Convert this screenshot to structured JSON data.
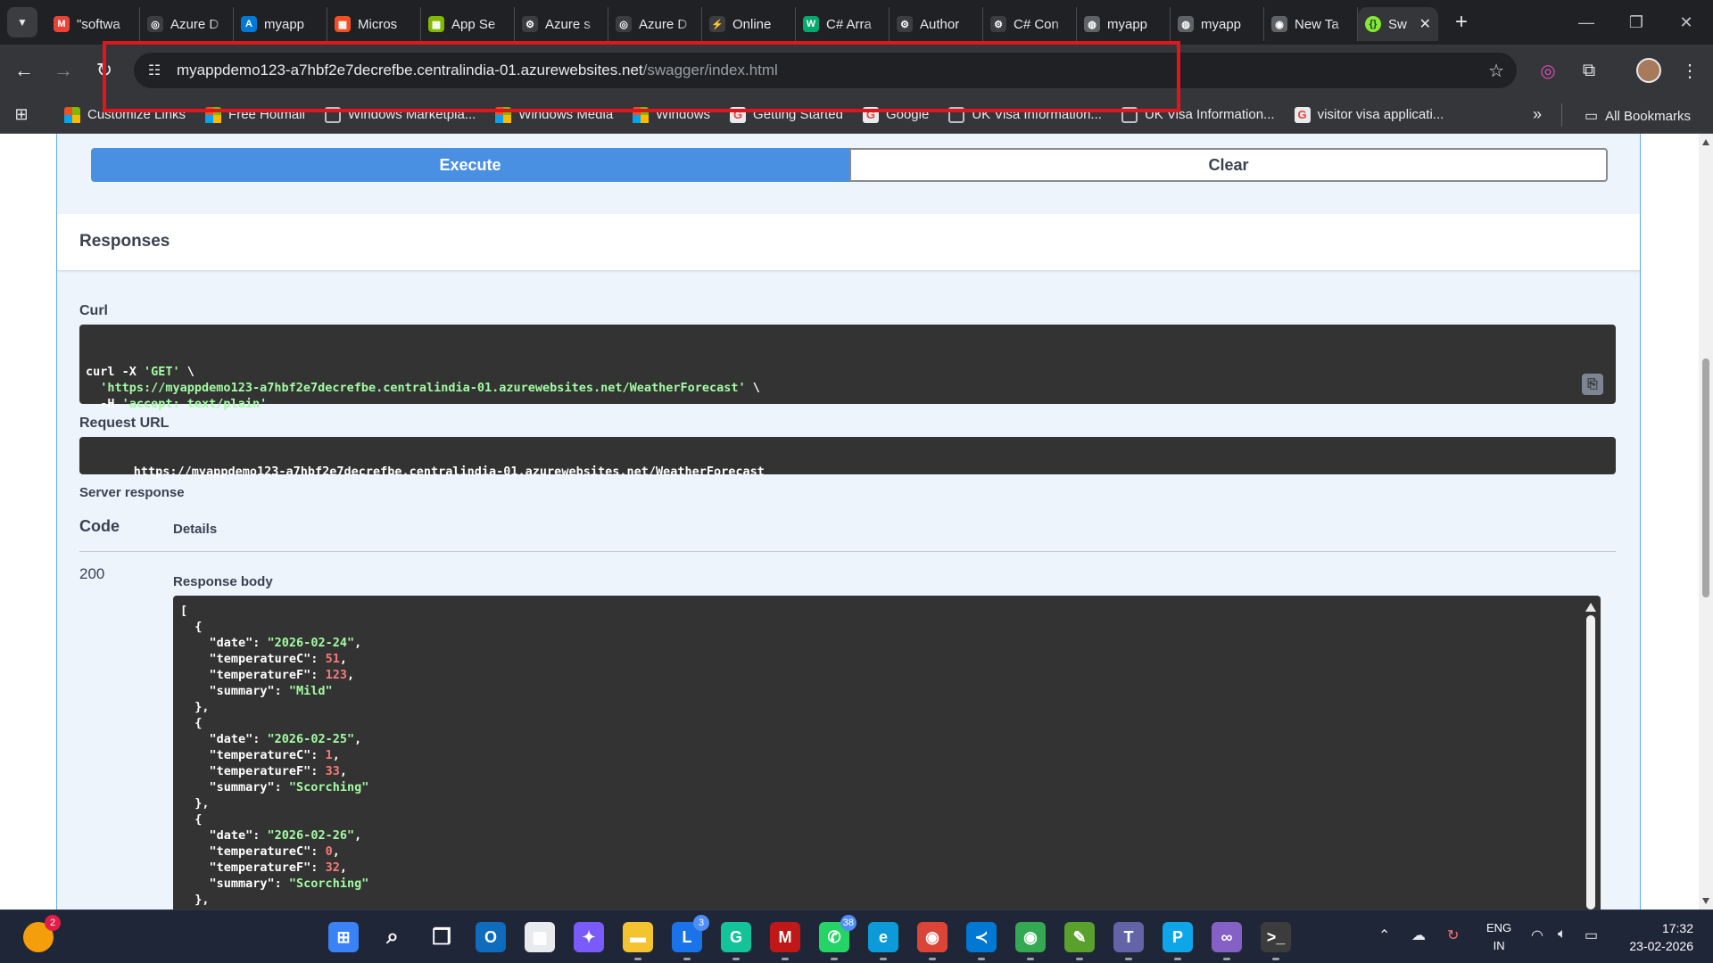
{
  "browser": {
    "tabs": [
      {
        "title": "\"softwa",
        "icon": "gmail-icon",
        "color": "#ea4335",
        "glyph": "M"
      },
      {
        "title": "Azure D",
        "icon": "openai-icon",
        "color": "#3c3d41",
        "glyph": "◎"
      },
      {
        "title": "myapp",
        "icon": "azure-icon",
        "color": "#0078d4",
        "glyph": "A"
      },
      {
        "title": "Micros",
        "icon": "microsoft-icon",
        "color": "#f25022",
        "glyph": "▦"
      },
      {
        "title": "App Se",
        "icon": "microsoft-icon",
        "color": "#7fba00",
        "glyph": "▦"
      },
      {
        "title": "Azure s",
        "icon": "azure-ai-icon",
        "color": "#3c3d41",
        "glyph": "⚙"
      },
      {
        "title": "Azure D",
        "icon": "openai-icon",
        "color": "#3c3d41",
        "glyph": "◎"
      },
      {
        "title": "Online",
        "icon": "online-icon",
        "color": "#3c3d41",
        "glyph": "⚡"
      },
      {
        "title": "C# Arra",
        "icon": "w3schools-icon",
        "color": "#04aa6d",
        "glyph": "W"
      },
      {
        "title": "Author",
        "icon": "azure-ai-icon",
        "color": "#3c3d41",
        "glyph": "⚙"
      },
      {
        "title": "C# Con",
        "icon": "azure-ai-icon",
        "color": "#3c3d41",
        "glyph": "⚙"
      },
      {
        "title": "myapp",
        "icon": "globe-icon",
        "color": "#5f6368",
        "glyph": "◍"
      },
      {
        "title": "myapp",
        "icon": "globe-icon",
        "color": "#5f6368",
        "glyph": "◍"
      },
      {
        "title": "New Ta",
        "icon": "chrome-icon",
        "color": "#5f6368",
        "glyph": "◉"
      }
    ],
    "active_tab": {
      "title": "Sw",
      "icon": "swagger-icon",
      "color": "#85ea2d",
      "glyph": "{}"
    },
    "url_host": "myappdemo123-a7hbf2e7decrefbe.centralindia-01.azurewebsites.net",
    "url_path": "/swagger/index.html",
    "bookmarks": [
      {
        "label": "Customize Links",
        "icon": "msgrid"
      },
      {
        "label": "Free Hotmail",
        "icon": "msgrid"
      },
      {
        "label": "Windows Marketpla...",
        "icon": "globe"
      },
      {
        "label": "Windows Media",
        "icon": "msgrid"
      },
      {
        "label": "Windows",
        "icon": "msgrid"
      },
      {
        "label": "Getting Started",
        "icon": "g"
      },
      {
        "label": "Google",
        "icon": "g"
      },
      {
        "label": "UK Visa Information...",
        "icon": "globe"
      },
      {
        "label": "UK Visa Information...",
        "icon": "globe"
      },
      {
        "label": "visitor visa applicati...",
        "icon": "g"
      }
    ],
    "all_bookmarks": "All Bookmarks"
  },
  "swagger": {
    "execute_label": "Execute",
    "clear_label": "Clear",
    "responses_title": "Responses",
    "curl_label": "Curl",
    "curl_lines": [
      {
        "plain": "curl -X ",
        "str": "'GET'",
        "tail": " \\"
      },
      {
        "plain": "  ",
        "str": "'https://myappdemo123-a7hbf2e7decrefbe.centralindia-01.azurewebsites.net/WeatherForecast'",
        "tail": " \\"
      },
      {
        "plain": "  -H ",
        "str": "'accept: text/plain'",
        "tail": ""
      }
    ],
    "request_url_label": "Request URL",
    "request_url": "https://myappdemo123-a7hbf2e7decrefbe.centralindia-01.azurewebsites.net/WeatherForecast",
    "server_response_label": "Server response",
    "code_header": "Code",
    "details_header": "Details",
    "status_code": "200",
    "response_body_label": "Response body",
    "response_items": [
      {
        "date": "\"2026-02-24\"",
        "temperatureC": "51",
        "temperatureF": "123",
        "summary": "\"Mild\""
      },
      {
        "date": "\"2026-02-25\"",
        "temperatureC": "1",
        "temperatureF": "33",
        "summary": "\"Scorching\""
      },
      {
        "date": "\"2026-02-26\"",
        "temperatureC": "0",
        "temperatureF": "32",
        "summary": "\"Scorching\""
      }
    ]
  },
  "taskbar": {
    "apps": [
      {
        "name": "start-icon",
        "glyph": "⊞",
        "color": "#3b82f6",
        "badge": ""
      },
      {
        "name": "search-icon",
        "glyph": "⌕",
        "color": "transparent",
        "badge": ""
      },
      {
        "name": "task-view-icon",
        "glyph": "❐",
        "color": "transparent",
        "badge": ""
      },
      {
        "name": "outlook-icon",
        "glyph": "O",
        "color": "#0f6cbd",
        "badge": ""
      },
      {
        "name": "store-icon",
        "glyph": "▦",
        "color": "#e8eaed",
        "badge": ""
      },
      {
        "name": "copilot-icon",
        "glyph": "✦",
        "color": "#7a5af8",
        "badge": ""
      },
      {
        "name": "file-explorer-icon",
        "glyph": "▬",
        "color": "#f4c430",
        "badge": ""
      },
      {
        "name": "l-app-icon",
        "glyph": "L",
        "color": "#1a73e8",
        "badge": "3"
      },
      {
        "name": "grammarly-icon",
        "glyph": "G",
        "color": "#15c39a",
        "badge": ""
      },
      {
        "name": "mcafee-icon",
        "glyph": "M",
        "color": "#c01818",
        "badge": ""
      },
      {
        "name": "whatsapp-icon",
        "glyph": "✆",
        "color": "#25d366",
        "badge": "38"
      },
      {
        "name": "edge-icon",
        "glyph": "e",
        "color": "#0c9bd8",
        "badge": ""
      },
      {
        "name": "chrome-dev-icon",
        "glyph": "◉",
        "color": "#db4437",
        "badge": ""
      },
      {
        "name": "vscode-icon",
        "glyph": "≺",
        "color": "#0078d4",
        "badge": ""
      },
      {
        "name": "chrome-icon",
        "glyph": "◉",
        "color": "#34a853",
        "badge": ""
      },
      {
        "name": "notepad-icon",
        "glyph": "✎",
        "color": "#5aa02c",
        "badge": ""
      },
      {
        "name": "teams-icon",
        "glyph": "T",
        "color": "#6264a7",
        "badge": ""
      },
      {
        "name": "p-app-icon",
        "glyph": "P",
        "color": "#0ea5e9",
        "badge": ""
      },
      {
        "name": "visual-studio-icon",
        "glyph": "∞",
        "color": "#8661c5",
        "badge": ""
      },
      {
        "name": "terminal-icon",
        "glyph": ">_",
        "color": "#3c3c3c",
        "badge": ""
      }
    ],
    "lang_line1": "ENG",
    "lang_line2": "IN",
    "time": "17:32",
    "date": "23-02-2026",
    "notification_badge": "2"
  }
}
